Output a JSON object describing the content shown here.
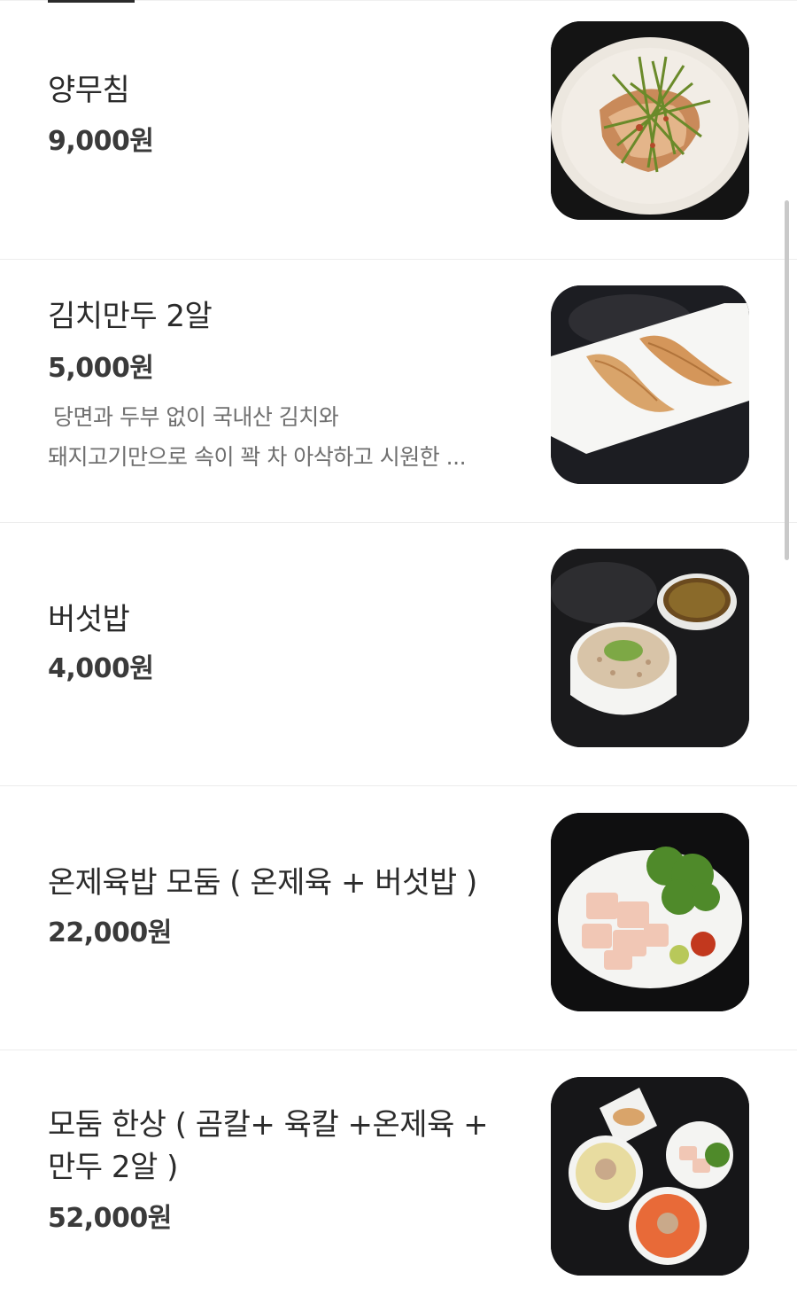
{
  "menu": {
    "items": [
      {
        "name": "양무침",
        "price": "9,000원",
        "desc": [],
        "photo": "yangmuchim-photo"
      },
      {
        "name": "김치만두 2알",
        "price": "5,000원",
        "desc": [
          "당면과 두부 없이 국내산 김치와",
          "돼지고기만으로 속이 꽉 차 아삭하고 시원한 ..."
        ],
        "photo": "kimchi-dumpling-photo"
      },
      {
        "name": "버섯밥",
        "price": "4,000원",
        "desc": [],
        "photo": "mushroom-rice-photo"
      },
      {
        "name": "온제육밥 모둠 ( 온제육 + 버섯밥 )",
        "price": "22,000원",
        "desc": [],
        "photo": "onjeyuk-platter-photo"
      },
      {
        "name": "모둠 한상 ( 곰칼+ 육칼 +온제육 +",
        "name_line2": "만두 2알 )",
        "price": "52,000원",
        "desc": [],
        "photo": "modum-hansang-photo"
      }
    ]
  }
}
